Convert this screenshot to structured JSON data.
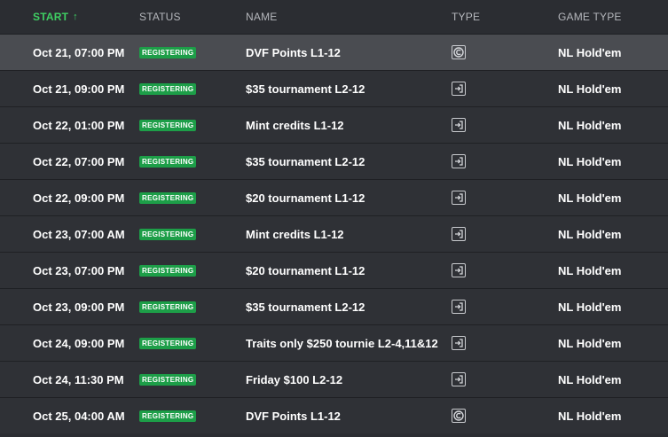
{
  "header": {
    "start": "START",
    "start_arrow": "↑",
    "status": "STATUS",
    "name": "NAME",
    "type": "TYPE",
    "game_type": "GAME TYPE"
  },
  "colors": {
    "accent": "#3fcf63",
    "badge": "#1d9e48",
    "row_bg": "#2f3136",
    "selected_row_bg": "#4a4c51"
  },
  "rows": [
    {
      "start": "Oct 21, 07:00 PM",
      "status": "REGISTERING",
      "name": "DVF Points L1-12",
      "type_icon": "points-icon",
      "game_type": "NL Hold'em"
    },
    {
      "start": "Oct 21, 09:00 PM",
      "status": "REGISTERING",
      "name": "$35 tournament L2-12",
      "type_icon": "buy-in-icon",
      "game_type": "NL Hold'em"
    },
    {
      "start": "Oct 22, 01:00 PM",
      "status": "REGISTERING",
      "name": "Mint credits L1-12",
      "type_icon": "buy-in-icon",
      "game_type": "NL Hold'em"
    },
    {
      "start": "Oct 22, 07:00 PM",
      "status": "REGISTERING",
      "name": "$35 tournament L2-12",
      "type_icon": "buy-in-icon",
      "game_type": "NL Hold'em"
    },
    {
      "start": "Oct 22, 09:00 PM",
      "status": "REGISTERING",
      "name": "$20 tournament L1-12",
      "type_icon": "buy-in-icon",
      "game_type": "NL Hold'em"
    },
    {
      "start": "Oct 23, 07:00 AM",
      "status": "REGISTERING",
      "name": "Mint credits L1-12",
      "type_icon": "buy-in-icon",
      "game_type": "NL Hold'em"
    },
    {
      "start": "Oct 23, 07:00 PM",
      "status": "REGISTERING",
      "name": "$20 tournament L1-12",
      "type_icon": "buy-in-icon",
      "game_type": "NL Hold'em"
    },
    {
      "start": "Oct 23, 09:00 PM",
      "status": "REGISTERING",
      "name": "$35 tournament L2-12",
      "type_icon": "buy-in-icon",
      "game_type": "NL Hold'em"
    },
    {
      "start": "Oct 24, 09:00 PM",
      "status": "REGISTERING",
      "name": "Traits only $250 tournie L2-4,11&12",
      "type_icon": "buy-in-icon",
      "game_type": "NL Hold'em"
    },
    {
      "start": "Oct 24, 11:30 PM",
      "status": "REGISTERING",
      "name": "Friday $100 L2-12",
      "type_icon": "buy-in-icon",
      "game_type": "NL Hold'em"
    },
    {
      "start": "Oct 25, 04:00 AM",
      "status": "REGISTERING",
      "name": "DVF Points L1-12",
      "type_icon": "points-icon",
      "game_type": "NL Hold'em"
    }
  ]
}
